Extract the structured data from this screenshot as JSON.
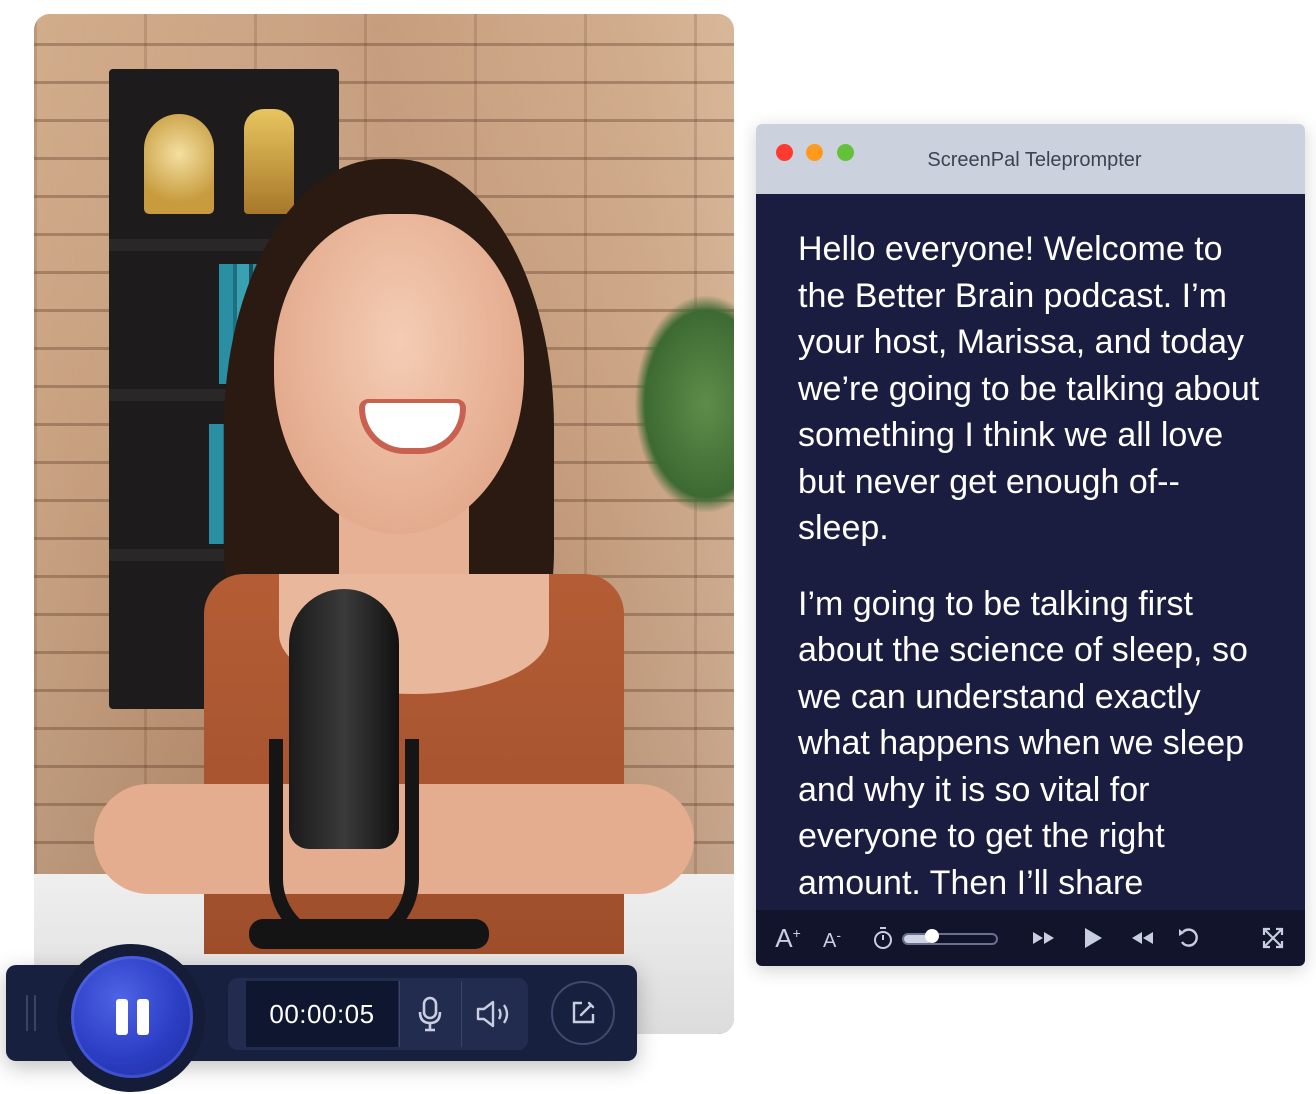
{
  "recorder": {
    "timer": "00:00:05",
    "state": "recording",
    "icons": {
      "pause": "pause-icon",
      "mic": "microphone-icon",
      "speaker": "speaker-icon",
      "edit": "edit-icon"
    }
  },
  "teleprompter": {
    "title": "ScreenPal Teleprompter",
    "window_controls": [
      "close",
      "minimize",
      "maximize"
    ],
    "colors": {
      "close": "#ff3b30",
      "minimize": "#ff9a1f",
      "maximize": "#63c23a",
      "background": "#1a1d40",
      "text": "#ffffff"
    },
    "paragraphs": [
      "Hello everyone! Welcome to the Better Brain podcast. I’m your host, Marissa, and today we’re going to be talking about something I think we all love but never get enough of-- sleep.",
      "I’m going to be talking first about the science of sleep, so we can understand exactly what happens when we sleep and why it is so vital for everyone to get the right amount. Then I’ll share"
    ],
    "controls": {
      "font_increase_label": "A",
      "font_increase_sup": "+",
      "font_decrease_label": "A",
      "font_decrease_sup": "-",
      "speed_level": 0.3,
      "icons": [
        "timer-icon",
        "fast-forward-icon",
        "play-icon",
        "rewind-icon",
        "restart-icon",
        "fullscreen-icon"
      ]
    }
  }
}
